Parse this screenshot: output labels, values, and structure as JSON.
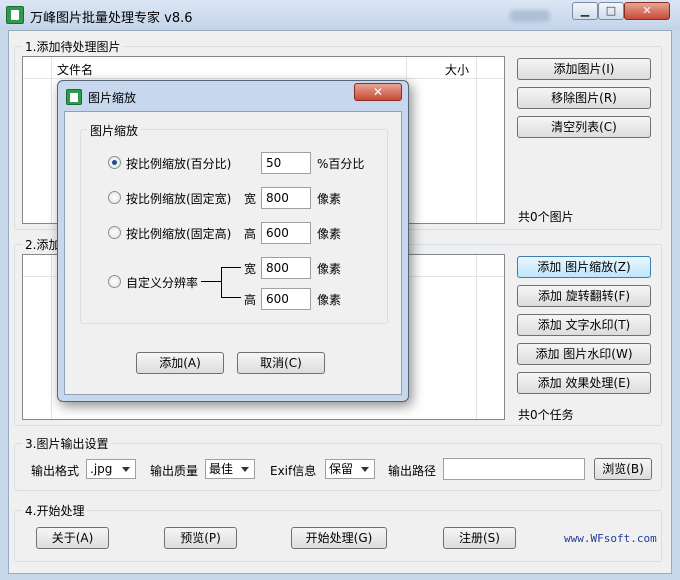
{
  "window": {
    "title": "万峰图片批量处理专家 v8.6",
    "min_glyph": "▁",
    "max_glyph": "□",
    "close_glyph": "✕"
  },
  "section1": {
    "label": "1.添加待处理图片",
    "columns": {
      "filename": "文件名",
      "size": "大小"
    },
    "buttons": {
      "add": "添加图片(I)",
      "remove": "移除图片(R)",
      "clear": "清空列表(C)"
    },
    "count": "共0个图片"
  },
  "section2": {
    "label": "2.添加",
    "buttons": {
      "resize": "添加 图片缩放(Z)",
      "rotate": "添加 旋转翻转(F)",
      "text_wm": "添加 文字水印(T)",
      "img_wm": "添加 图片水印(W)",
      "effect": "添加 效果处理(E)"
    },
    "count": "共0个任务"
  },
  "section3": {
    "label": "3.图片输出设置",
    "format_label": "输出格式",
    "format_value": ".jpg",
    "quality_label": "输出质量",
    "quality_value": "最佳",
    "exif_label": "Exif信息",
    "exif_value": "保留",
    "path_label": "输出路径",
    "path_value": "",
    "browse": "浏览(B)"
  },
  "section4": {
    "label": "4.开始处理",
    "buttons": {
      "about": "关于(A)",
      "preview": "预览(P)",
      "start": "开始处理(G)",
      "register": "注册(S)"
    },
    "site": "www.WFsoft.com"
  },
  "dialog": {
    "title": "图片缩放",
    "close_glyph": "✕",
    "group_label": "图片缩放",
    "options": {
      "percent": {
        "label": "按比例缩放(百分比)",
        "value": "50",
        "unit": "%百分比",
        "selected": true
      },
      "fixed_width": {
        "label": "按比例缩放(固定宽)",
        "prefix": "宽",
        "value": "800",
        "unit": "像素"
      },
      "fixed_height": {
        "label": "按比例缩放(固定高)",
        "prefix": "高",
        "value": "600",
        "unit": "像素"
      },
      "custom": {
        "label": "自定义分辨率",
        "w_prefix": "宽",
        "w_value": "800",
        "w_unit": "像素",
        "h_prefix": "高",
        "h_value": "600",
        "h_unit": "像素"
      }
    },
    "buttons": {
      "add": "添加(A)",
      "cancel": "取消(C)"
    }
  }
}
